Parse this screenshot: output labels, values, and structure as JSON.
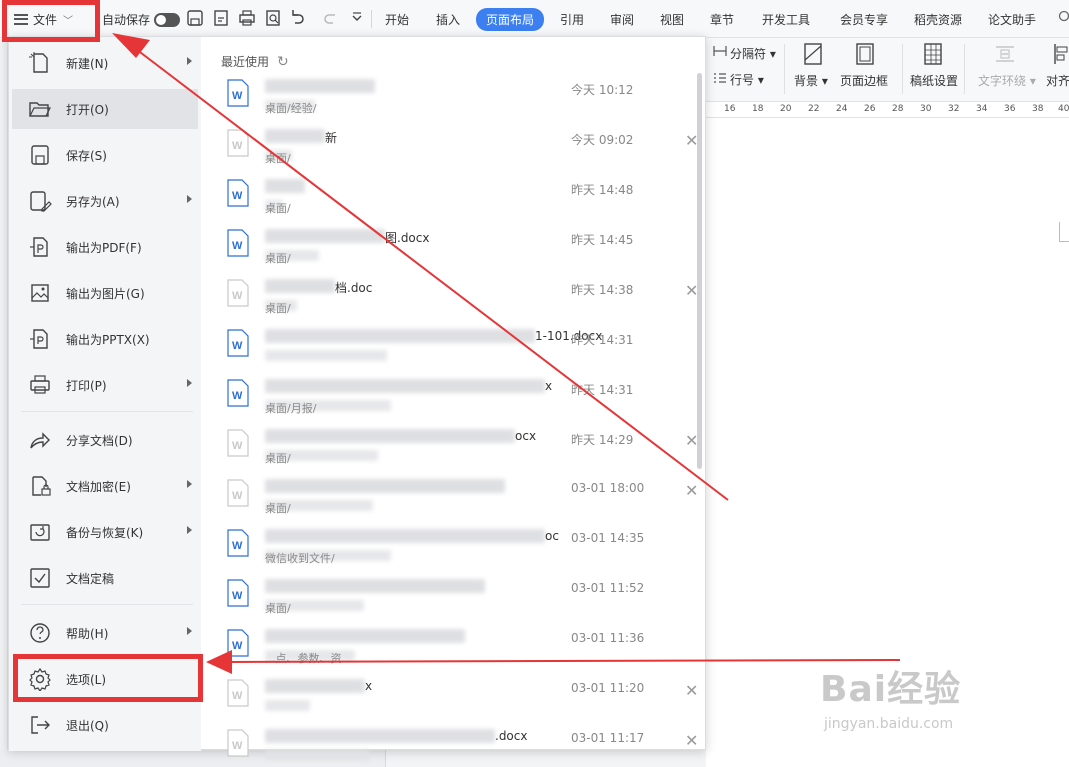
{
  "toolbar": {
    "file_label": "文件",
    "autosave_label": "自动保存",
    "tabs": [
      "开始",
      "插入",
      "页面布局",
      "引用",
      "审阅",
      "视图",
      "章节",
      "开发工具",
      "会员专享",
      "稻壳资源",
      "论文助手"
    ],
    "active_tab": "页面布局"
  },
  "ribbon": {
    "column_break": "分隔符",
    "line_number": "行号",
    "background": "背景",
    "page_border": "页面边框",
    "manuscript": "稿纸设置",
    "text_wrap": "文字环绕",
    "align": "对齐",
    "ruler_ticks": [
      "16",
      "18",
      "20",
      "22",
      "24",
      "26",
      "28",
      "30",
      "32",
      "34",
      "36",
      "38",
      "40"
    ]
  },
  "file_menu": {
    "items": [
      {
        "label": "新建(N)",
        "icon": "new-doc-icon",
        "submenu": true
      },
      {
        "label": "打开(O)",
        "icon": "folder-open-icon",
        "submenu": false,
        "selected": true
      },
      {
        "label": "保存(S)",
        "icon": "save-icon",
        "submenu": false
      },
      {
        "label": "另存为(A)",
        "icon": "save-as-icon",
        "submenu": true
      },
      {
        "label": "输出为PDF(F)",
        "icon": "export-pdf-icon",
        "submenu": false
      },
      {
        "label": "输出为图片(G)",
        "icon": "export-image-icon",
        "submenu": false
      },
      {
        "label": "输出为PPTX(X)",
        "icon": "export-pptx-icon",
        "submenu": false
      },
      {
        "label": "打印(P)",
        "icon": "print-icon",
        "submenu": true
      },
      {
        "label": "分享文档(D)",
        "icon": "share-icon",
        "submenu": false
      },
      {
        "label": "文档加密(E)",
        "icon": "encrypt-icon",
        "submenu": true
      },
      {
        "label": "备份与恢复(K)",
        "icon": "backup-icon",
        "submenu": true
      },
      {
        "label": "文档定稿",
        "icon": "finalize-icon",
        "submenu": false
      },
      {
        "label": "帮助(H)",
        "icon": "help-icon",
        "submenu": true
      },
      {
        "label": "选项(L)",
        "icon": "gear-icon",
        "submenu": false
      },
      {
        "label": "退出(Q)",
        "icon": "exit-icon",
        "submenu": false
      }
    ]
  },
  "recent": {
    "header": "最近使用",
    "files": [
      {
        "name": "",
        "path": "桌面/经验/",
        "time": "今天 10:12",
        "closable": false
      },
      {
        "name": "新",
        "path": "桌面/",
        "time": "今天 09:02",
        "closable": true
      },
      {
        "name": "",
        "path": "桌面/",
        "time": "昨天 14:48",
        "closable": false
      },
      {
        "name": "图.docx",
        "path": "桌面/",
        "time": "昨天 14:45",
        "closable": false
      },
      {
        "name": "档.doc",
        "path": "桌面/",
        "time": "昨天 14:38",
        "closable": true
      },
      {
        "name": "1-101.docx",
        "path": "",
        "time": "昨天 14:31",
        "closable": false
      },
      {
        "name": "x",
        "path": "桌面/月报/",
        "time": "昨天 14:31",
        "closable": false
      },
      {
        "name": "ocx",
        "path": "桌面/",
        "time": "昨天 14:29",
        "closable": true
      },
      {
        "name": "",
        "path": "桌面/",
        "time": "03-01 18:00",
        "closable": true
      },
      {
        "name": "oc",
        "path": "微信收到文件/",
        "time": "03-01 14:35",
        "closable": false
      },
      {
        "name": "",
        "path": "桌面/",
        "time": "03-01 11:52",
        "closable": false
      },
      {
        "name": "",
        "path": "...点、参数、资...",
        "time": "03-01 11:36",
        "closable": false
      },
      {
        "name": "x",
        "path": "",
        "time": "03-01 11:20",
        "closable": true
      },
      {
        "name": ".docx",
        "path": "",
        "time": "03-01 11:17",
        "closable": true
      }
    ]
  },
  "watermark": {
    "brand": "Bai经验",
    "url": "jingyan.baidu.com"
  },
  "colors": {
    "accent": "#3b7ff0",
    "annotation": "#e63537"
  }
}
